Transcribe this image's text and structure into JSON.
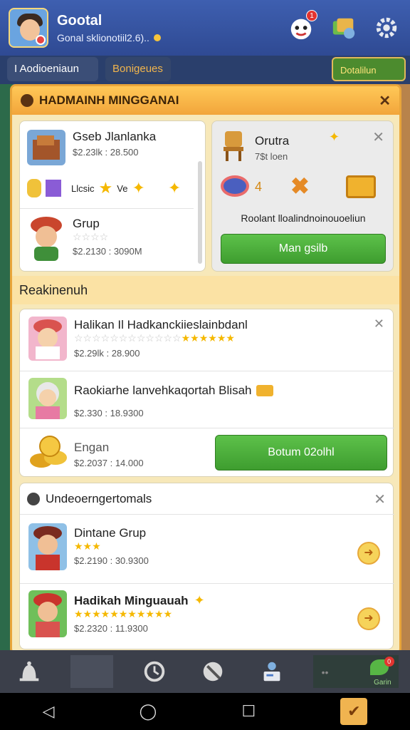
{
  "header": {
    "title": "Gootal",
    "subtitle": "Gonal sklionotiil2.6)..",
    "notif_badge": "1"
  },
  "tabs": [
    {
      "label": "I Aodioeniaun"
    },
    {
      "label": "Bonigeues"
    },
    {
      "label": "Dotalilun"
    }
  ],
  "panel": {
    "title": "HADMAINH MINGGANAI",
    "close": "✕"
  },
  "featured": {
    "item1": {
      "title": "Gseb Jlanlanka",
      "price": "$2.23lk : 28.500"
    },
    "row_labels": [
      "Llcsic",
      "Ve"
    ],
    "item2": {
      "title": "Grup",
      "price": "$2.2130 : 3090M"
    }
  },
  "offer": {
    "title": "Orutra",
    "sub": "7$t loen",
    "count": "4",
    "desc": "Roolant lloalindnoinouoeliun",
    "button": "Man gsilb"
  },
  "section1": {
    "label": "Reakinenuh",
    "items": [
      {
        "title": "Halikan Il Hadkanckiieslainbdanl",
        "price": "$2.29lk : 28.900"
      },
      {
        "title": "Raokiarhe lanvehkaqortah Blisah",
        "price": "$2.330 : 18.9300"
      },
      {
        "title": "Engan",
        "price": "$2.2037 : 14.000"
      }
    ],
    "button": "Botum 02olhl"
  },
  "section2": {
    "label": "Undeoerngertomals",
    "items": [
      {
        "title": "Dintane Grup",
        "price": "$2.2190 : 30.9300"
      },
      {
        "title": "Hadikah Minguauah",
        "price": "$2.2320 : 11.9300"
      }
    ]
  },
  "dock": {
    "active_badge": "0",
    "active_label": "Garin"
  },
  "colors": {
    "accent": "#f2a53b",
    "green": "#3e9d2f",
    "topbar": "#3e5fb0"
  }
}
